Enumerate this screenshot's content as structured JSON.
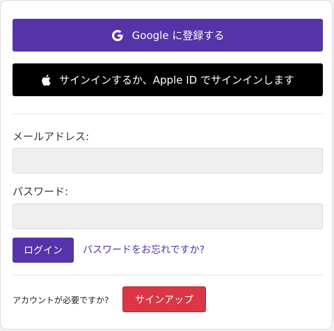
{
  "social": {
    "google_label": "Google に登録する",
    "google_icon": "google-g-icon",
    "apple_label": "サインインするか、Apple ID でサインインします",
    "apple_icon": "apple-logo-icon"
  },
  "form": {
    "email_label": "メールアドレス:",
    "email_value": "",
    "password_label": "パスワード:",
    "password_value": "",
    "login_button": "ログイン",
    "forgot_link": "パスワードをお忘れですか?"
  },
  "signup": {
    "question": "アカウントが必要ですか?",
    "button": "サインアップ"
  },
  "colors": {
    "primary": "#5533a8",
    "apple": "#000000",
    "danger": "#dc3545",
    "field_bg": "#efefef"
  }
}
